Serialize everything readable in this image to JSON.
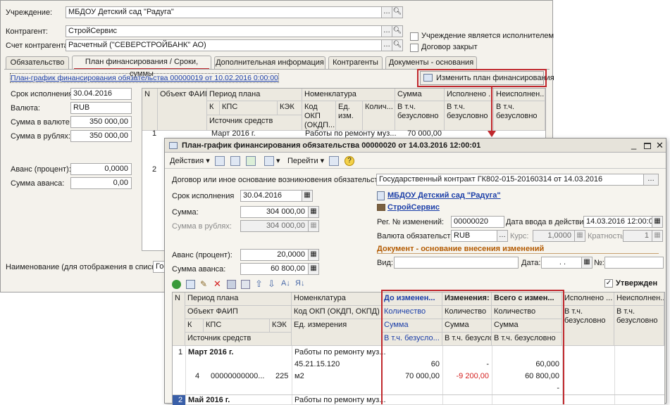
{
  "back": {
    "institution_label": "Учреждение:",
    "institution_value": "МБДОУ Детский сад \"Радуга\"",
    "counterparty_label": "Контрагент:",
    "counterparty_value": "СтройСервис",
    "account_label": "Счет контрагента:",
    "account_value": "Расчетный (\"СЕВЕРСТРОЙБАНК\" АО)",
    "chk_executor": "Учреждение является исполнителем",
    "chk_closed": "Договор закрыт",
    "tabs": [
      "Обязательство",
      "План финансирования / Сроки, суммы",
      "Дополнительная информация",
      "Контрагенты",
      "Документы - основания"
    ],
    "plan_link": "План-график финансирования обязательства 00000019 от 10.02.2016 0:00:00",
    "change_plan_button": "Изменить план финансирования",
    "term_label": "Срок исполнения",
    "term_value": "30.04.2016",
    "currency_label": "Валюта:",
    "currency_value": "RUB",
    "sum_cur_label": "Сумма в валюте:",
    "sum_cur_value": "350 000,00",
    "sum_rub_label": "Сумма в рублях:",
    "sum_rub_value": "350 000,00",
    "advance_pct_label": "Аванс (процент):",
    "advance_pct_value": "0,0000",
    "advance_sum_label": "Сумма аванса:",
    "advance_sum_value": "0,00",
    "name_label": "Наименование (для отображения в списках):",
    "name_value": "Гос",
    "grid": {
      "h_n": "N",
      "h_obj": "Объект ФАИП",
      "h_period": "Период плана",
      "h_kps": "КПС",
      "h_k": "К",
      "h_kek": "КЭК",
      "h_source": "Источник средств",
      "h_nom": "Номенклатура",
      "h_okp": "Код ОКП (ОКДП...",
      "h_unit": "Ед. изм.",
      "h_qty": "Колич...",
      "h_sum": "Сумма",
      "h_sum2": "В т.ч. безусловно",
      "h_exec": "Исполнено ...",
      "h_exec2": "В т.ч. безусловно",
      "h_nexec": "Неисполнен...",
      "h_nexec2": "В т.ч. безусловно",
      "r1_n": "1",
      "r1_period": "Март 2016 г.",
      "r1_nom": "Работы по ремонту муз...",
      "r1_sum": "70 000,00",
      "r2_n": "2"
    }
  },
  "front": {
    "title": "План-график финансирования обязательства 00000020 от 14.03.2016 12:00:01",
    "actions": "Действия",
    "goto": "Перейти",
    "contract_label": "Договор или иное основание возникновения обязательства:",
    "contract_value": "Государственный контракт ГК802-015-20160314 от 14.03.2016",
    "term_label": "Срок исполнения",
    "term_value": "30.04.2016",
    "institution_link": "МБДОУ Детский сад \"Радуга\"",
    "counterparty_link": "СтройСервис",
    "sum_label": "Сумма:",
    "sum_value": "304 000,00",
    "sum_rub_label": "Сумма в рублях:",
    "sum_rub_value": "304 000,00",
    "regno_label": "Рег. № изменений:",
    "regno_value": "00000020",
    "date_label": "Дата ввода в действие:",
    "date_value": "14.03.2016 12:00:01",
    "currency_label": "Валюта обязательства:",
    "currency_value": "RUB",
    "rate_label": "Курс:",
    "rate_value": "1,0000",
    "mult_label": "Кратность:",
    "mult_value": "1",
    "doc_header": "Документ - основание внесения изменений",
    "kind_label": "Вид:",
    "date2_label": "Дата:",
    "date2_value": ". .",
    "no_label": "№:",
    "advance_pct_label": "Аванс (процент):",
    "advance_pct_value": "20,0000",
    "advance_sum_label": "Сумма аванса:",
    "advance_sum_value": "60 800,00",
    "approved": "Утвержден",
    "grid": {
      "h_n": "N",
      "h_period": "Период плана",
      "h_obj": "Объект ФАИП",
      "h_k": "К",
      "h_kps": "КПС",
      "h_kek": "КЭК",
      "h_source": "Источник средств",
      "h_nom": "Номенклатура",
      "h_okp": "Код ОКП (ОКДП, ОКПД)",
      "h_unit": "Ед. измерения",
      "h_before": "До изменен...",
      "h_qty": "Количество",
      "h_sum": "Сумма",
      "h_uncond": "В т.ч. безусло...",
      "h_change": "Изменения:",
      "h_qty2": "Количество",
      "h_sum2": "Сумма",
      "h_uncond2": "В т.ч. безусло...",
      "h_total": "Всего с измен...",
      "h_qty3": "Количество",
      "h_sum3": "Сумма",
      "h_uncond3": "В т.ч. безусловно",
      "h_exec": "Исполнено ...",
      "h_exec2": "В т.ч. безусловно",
      "h_nexec": "Неисполнен...",
      "h_nexec2": "В т.ч. безусловно",
      "r1_n": "1",
      "r1_period": "Март 2016 г.",
      "r1_nom": "Работы по ремонту муз...",
      "r1_okp": "45.21.15.120",
      "r1_unit": "м2",
      "r1_k": "4",
      "r1_kps": "00000000000...",
      "r1_kek": "225",
      "r1_b_qty": "60",
      "r1_b_sum": "70 000,00",
      "r1_c_qty": "-",
      "r1_c_sum": "-9 200,00",
      "r1_t_qty": "60,000",
      "r1_t_sum": "60 800,00",
      "r1_t_unc": "-",
      "r2_n": "2",
      "r2_period": "Май 2016 г.",
      "r2_nom": "Работы по ремонту муз..."
    }
  }
}
